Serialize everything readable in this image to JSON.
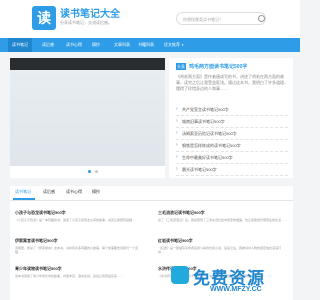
{
  "header": {
    "logo_icon": "book-icon",
    "logo_char": "读",
    "title": "读书笔记大全",
    "subtitle": "分享读书笔记，交流读后感。",
    "search_placeholder": "你想找哪类读书笔记？"
  },
  "nav": {
    "items": [
      {
        "label": "读书笔记"
      },
      {
        "label": "读后感"
      },
      {
        "label": "读书心得"
      },
      {
        "label": "摘抄"
      },
      {
        "label": "文章列表"
      },
      {
        "label": "书籍列表"
      },
      {
        "label": "优文推荐"
      }
    ]
  },
  "featured": {
    "badge": "头条",
    "title": "鸡毛两方面读书笔记500字",
    "body": "《鸡毛两方面》是作者唐成写的书，讲述了鸡毛在两方面的故事，读完之后让我受益匪浅。通过这本书，我明白了许多道理，懂得了珍惜身边的人和事……",
    "list": [
      "共产党宣言读书笔记500字",
      "城南旧事读书笔记500字",
      "汤姆索亚历险记读书笔记500字",
      "钢铁是怎样炼成的读书笔记500字",
      "生命中最美好读书笔记500字",
      "晨光读书笔记500字"
    ]
  },
  "tabs": [
    "读书笔记",
    "读后感",
    "读书心得",
    "摘抄"
  ],
  "cards": [
    {
      "title": "小孩子与恐龙读书笔记500字",
      "body": "《小孩子与恐龙》是一本有趣的书，讲述了小孩子和恐龙之间的故事，读完让我很有感触……"
    },
    {
      "title": "三毛流浪记读书笔记500字",
      "body": "读了《三毛流浪记》后，我感受到了三毛在旧社会中的悲惨遭遇，也让我更加珍惜现在的生活……"
    },
    {
      "title": "伊索寓言读书笔记500字",
      "body": "寒假里，我读了《伊索寓言》这本书，书中有许多有趣的小故事，每个故事都告诉我们一个道理……"
    },
    {
      "title": "红岩读书笔记500字",
      "body": "《红岩》是一部描写革命者英勇斗争的长篇小说，读完之后，我被书中人物的坚定信念深深打动……"
    },
    {
      "title": "青少年读物读书笔记500字",
      "body": "这本书讲述了青少年成长中的故事，内容丰富，语言生动，读后让我受益良多……"
    },
    {
      "title": "水浒传读书笔记500字",
      "body": "《水浒传》是我国古典四大名著之一，书中描写了一百零八位好汉的故事……"
    }
  ],
  "watermark": {
    "text": "免费资源",
    "url": "WWW.MFZY.CC"
  },
  "colors": {
    "accent": "#2e9ce6",
    "nav_active": "#1f86cf"
  }
}
